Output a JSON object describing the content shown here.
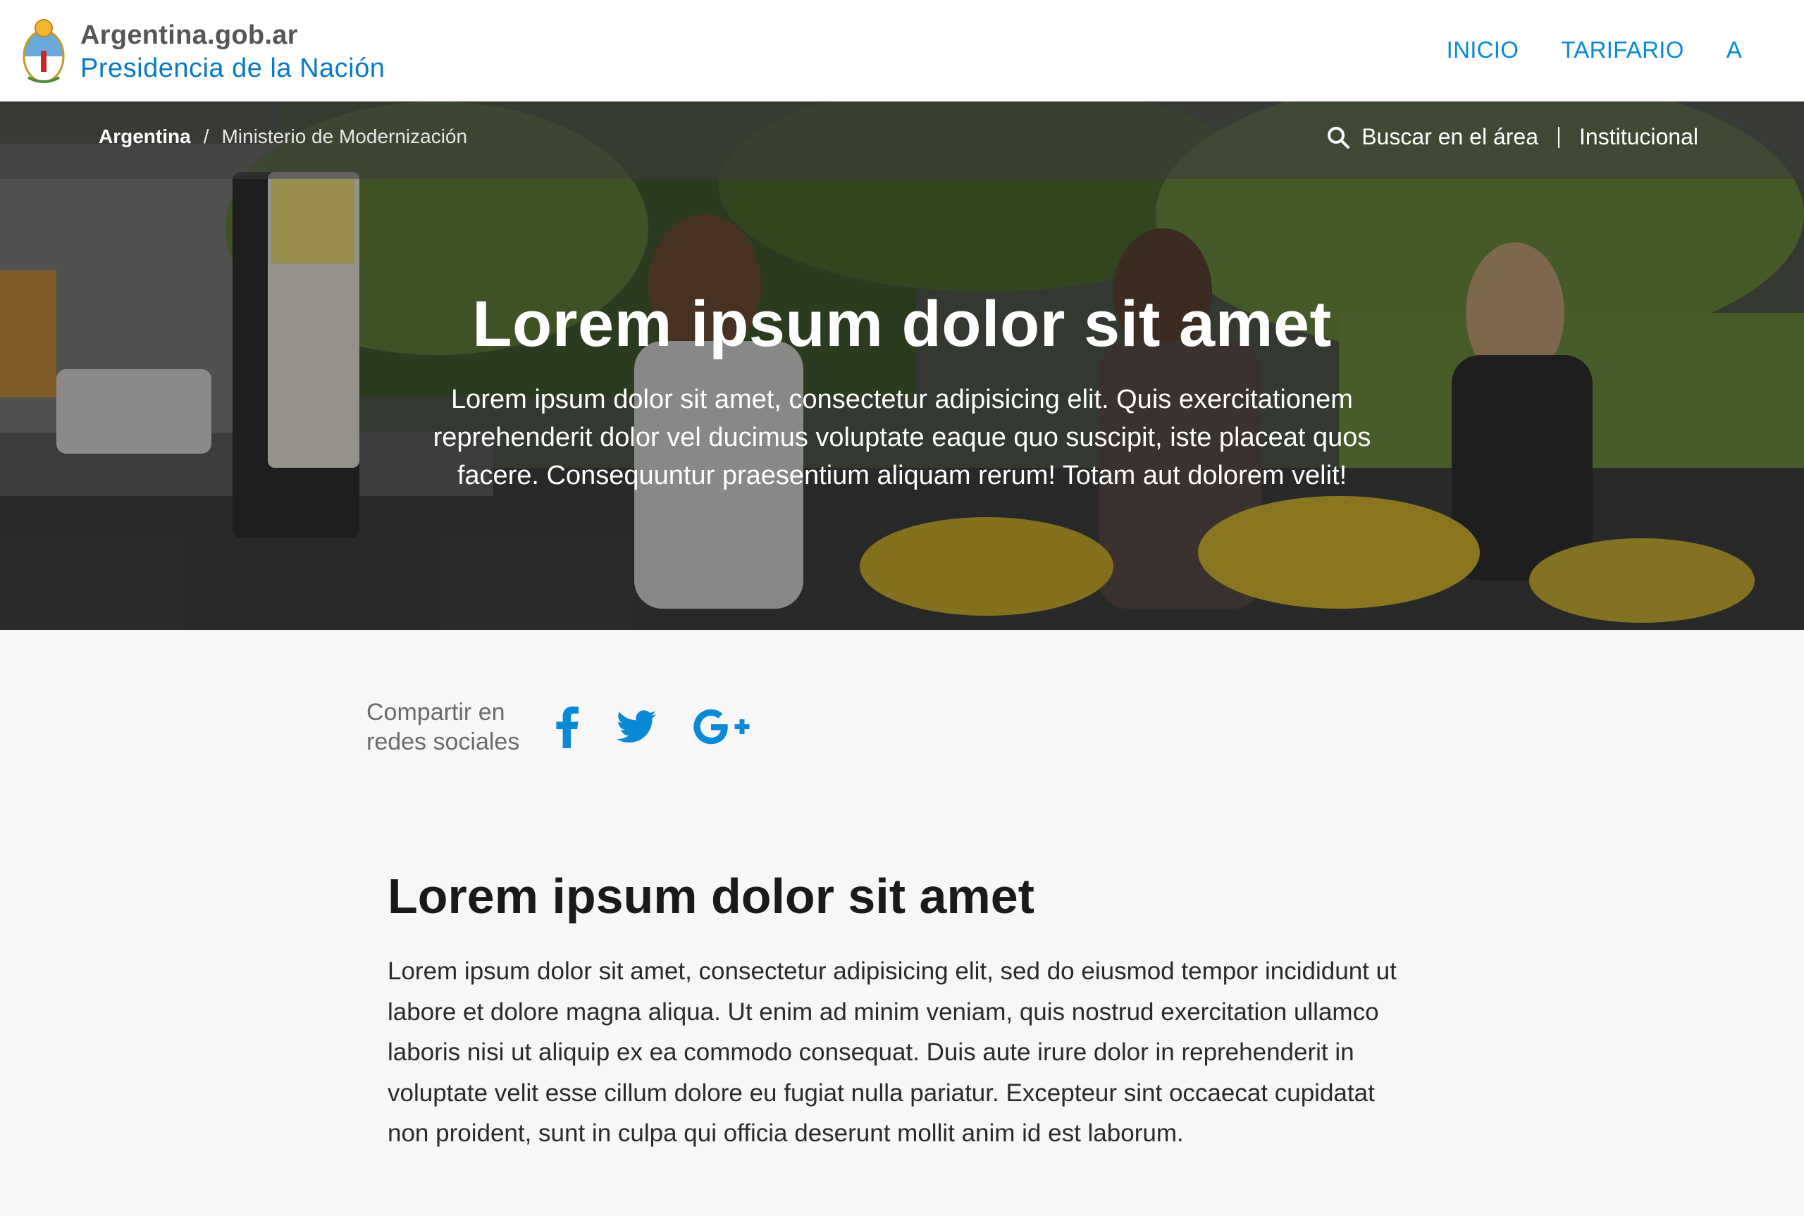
{
  "header": {
    "brand_line1": "Argentina.gob.ar",
    "brand_line2": "Presidencia de la Nación",
    "nav": [
      {
        "label": "INICIO"
      },
      {
        "label": "TARIFARIO"
      },
      {
        "label": "A"
      }
    ]
  },
  "hero": {
    "breadcrumb": {
      "root": "Argentina",
      "separator": "/",
      "current": "Ministerio de Modernización"
    },
    "search_label": "Buscar en el área",
    "institucional_label": "Institucional",
    "title": "Lorem ipsum dolor sit amet",
    "subtitle": "Lorem ipsum dolor sit amet, consectetur adipisicing elit. Quis exercitationem reprehenderit dolor vel ducimus voluptate eaque quo suscipit, iste placeat quos facere. Consequuntur praesentium aliquam rerum! Totam aut dolorem velit!"
  },
  "share": {
    "label_line1": "Compartir en",
    "label_line2": "redes sociales",
    "icons": [
      "facebook-icon",
      "twitter-icon",
      "google-plus-icon"
    ]
  },
  "content": {
    "title": "Lorem ipsum dolor sit amet",
    "body": "Lorem ipsum dolor sit amet, consectetur adipisicing elit, sed do eiusmod tempor incididunt ut labore et dolore magna aliqua. Ut enim ad minim veniam, quis nostrud exercitation ullamco laboris nisi ut aliquip ex ea commodo consequat. Duis aute irure dolor in reprehenderit in voluptate velit esse cillum dolore eu fugiat nulla pariatur. Excepteur sint occaecat cupidatat non proident, sunt in culpa qui officia deserunt mollit anim id est laborum."
  },
  "colors": {
    "brand_blue": "#0a7ac6",
    "nav_blue": "#0a8ad6",
    "social_blue": "#0a8ad6",
    "page_bg": "#f7f7f7"
  }
}
